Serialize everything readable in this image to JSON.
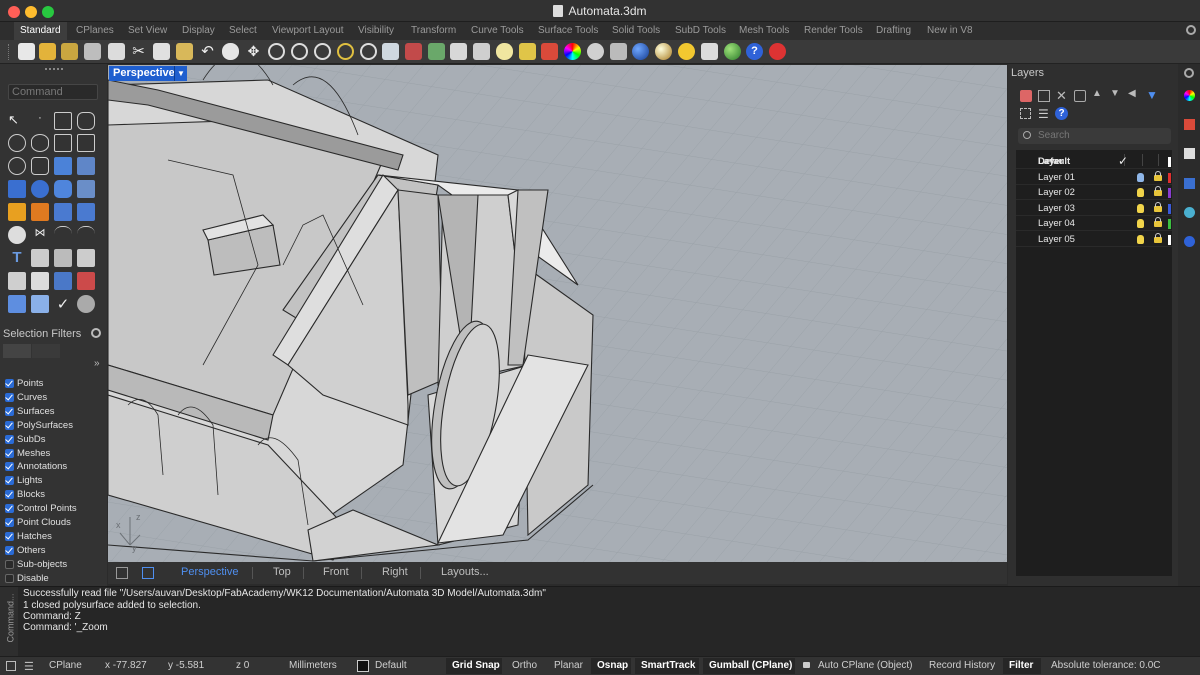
{
  "window": {
    "title": "Automata.3dm"
  },
  "tabs": [
    "Standard",
    "CPlanes",
    "Set View",
    "Display",
    "Select",
    "Viewport Layout",
    "Visibility",
    "Transform",
    "Curve Tools",
    "Surface Tools",
    "Solid Tools",
    "SubD Tools",
    "Mesh Tools",
    "Render Tools",
    "Drafting",
    "New in V8"
  ],
  "left_panel": {
    "command_placeholder": "Command",
    "selection_filters_title": "Selection Filters",
    "filters": [
      {
        "label": "Points",
        "checked": true
      },
      {
        "label": "Curves",
        "checked": true
      },
      {
        "label": "Surfaces",
        "checked": true
      },
      {
        "label": "PolySurfaces",
        "checked": true
      },
      {
        "label": "SubDs",
        "checked": true
      },
      {
        "label": "Meshes",
        "checked": true
      },
      {
        "label": "Annotations",
        "checked": true
      },
      {
        "label": "Lights",
        "checked": true
      },
      {
        "label": "Blocks",
        "checked": true
      },
      {
        "label": "Control Points",
        "checked": true
      },
      {
        "label": "Point Clouds",
        "checked": true
      },
      {
        "label": "Hatches",
        "checked": true
      },
      {
        "label": "Others",
        "checked": true
      },
      {
        "label": "Sub-objects",
        "checked": false
      },
      {
        "label": "Disable",
        "checked": false
      }
    ]
  },
  "viewport": {
    "label": "Perspective",
    "tabs": [
      "Perspective",
      "Top",
      "Front",
      "Right",
      "Layouts..."
    ],
    "axis_x": "x",
    "axis_y": "y",
    "axis_z": "z"
  },
  "layers_panel": {
    "title": "Layers",
    "search_placeholder": "Search",
    "header": "Layer",
    "layers": [
      {
        "name": "Default",
        "current": true,
        "color": "#ffffff"
      },
      {
        "name": "Layer 01",
        "current": false,
        "color": "#e03030"
      },
      {
        "name": "Layer 02",
        "current": false,
        "color": "#8a3cd0"
      },
      {
        "name": "Layer 03",
        "current": false,
        "color": "#3a5ad8"
      },
      {
        "name": "Layer 04",
        "current": false,
        "color": "#3cc040"
      },
      {
        "name": "Layer 05",
        "current": false,
        "color": "#ffffff"
      }
    ]
  },
  "history": {
    "side_label": "Command...",
    "lines": [
      "Successfully read file \"/Users/auvan/Desktop/FabAcademy/WK12 Documentation/Automata 3D Model/Automata.3dm\"",
      "1 closed polysurface added to selection.",
      "Command: Z",
      "Command: '_Zoom"
    ]
  },
  "status": {
    "cplane": "CPlane",
    "x": "x -77.827",
    "y": "y -5.581",
    "z": "z 0",
    "units": "Millimeters",
    "layer": "Default",
    "grid_snap": "Grid Snap",
    "ortho": "Ortho",
    "planar": "Planar",
    "osnap": "Osnap",
    "smarttrack": "SmartTrack",
    "gumball": "Gumball (CPlane)",
    "auto_cplane": "Auto CPlane (Object)",
    "record_history": "Record History",
    "filter": "Filter",
    "tolerance": "Absolute tolerance: 0.0C"
  },
  "colors": {
    "accent": "#2a6bd6",
    "viewport_bg": "#a6adb4",
    "active_tab": "#4f8ff0"
  }
}
